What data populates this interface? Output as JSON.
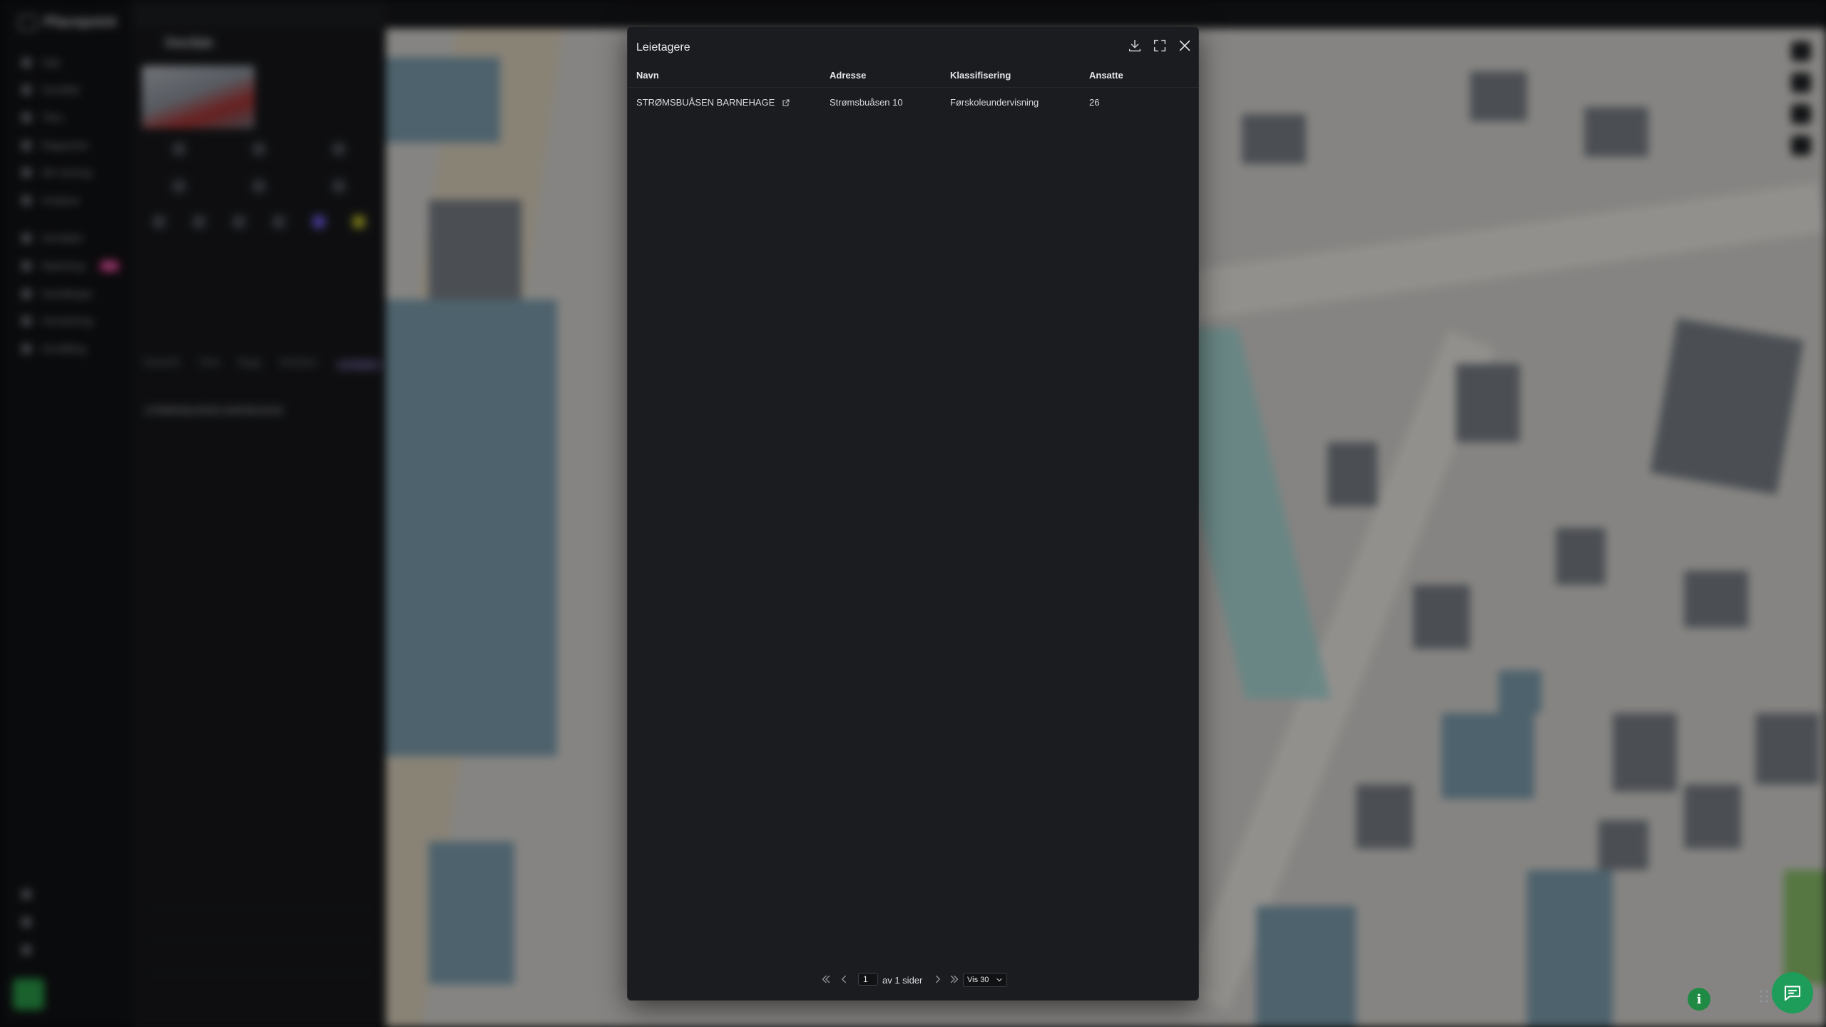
{
  "app": {
    "name": "Placepoint",
    "nav_items": [
      "Søk",
      "Område",
      "Tiles",
      "Rapporter",
      "3D-visning",
      "Analyse",
      "Områder",
      "Matching",
      "Handlinger",
      "Omsetning",
      "Innstilling"
    ],
    "nav_badge": "Ny",
    "panel_title": "Område",
    "panel_tabs": [
      "Generelt",
      "Tomt",
      "Bygg",
      "Eiendom",
      "Leietagere"
    ]
  },
  "modal": {
    "title": "Leietagere",
    "columns": [
      "Navn",
      "Adresse",
      "Klassifisering",
      "Ansatte"
    ],
    "rows": [
      {
        "name": "STRØMSBUÅSEN BARNEHAGE",
        "address": "Strømsbuåsen 10",
        "classification": "Førskoleundervisning",
        "employees": "26"
      }
    ],
    "pager": {
      "current_page": "1",
      "of_text": "av 1 sider",
      "page_size": "Vis 30"
    }
  },
  "colors": {
    "modal_bg": "#1b1c1f",
    "accent_green": "#1e9c59",
    "map_building": "#7a8088",
    "map_water_roof": "#7e9fb0"
  },
  "icons": {
    "download": "download-icon",
    "fullscreen": "fullscreen-icon",
    "close": "close-icon",
    "external_link": "external-link-icon",
    "info": "info-icon",
    "chat": "chat-icon"
  }
}
